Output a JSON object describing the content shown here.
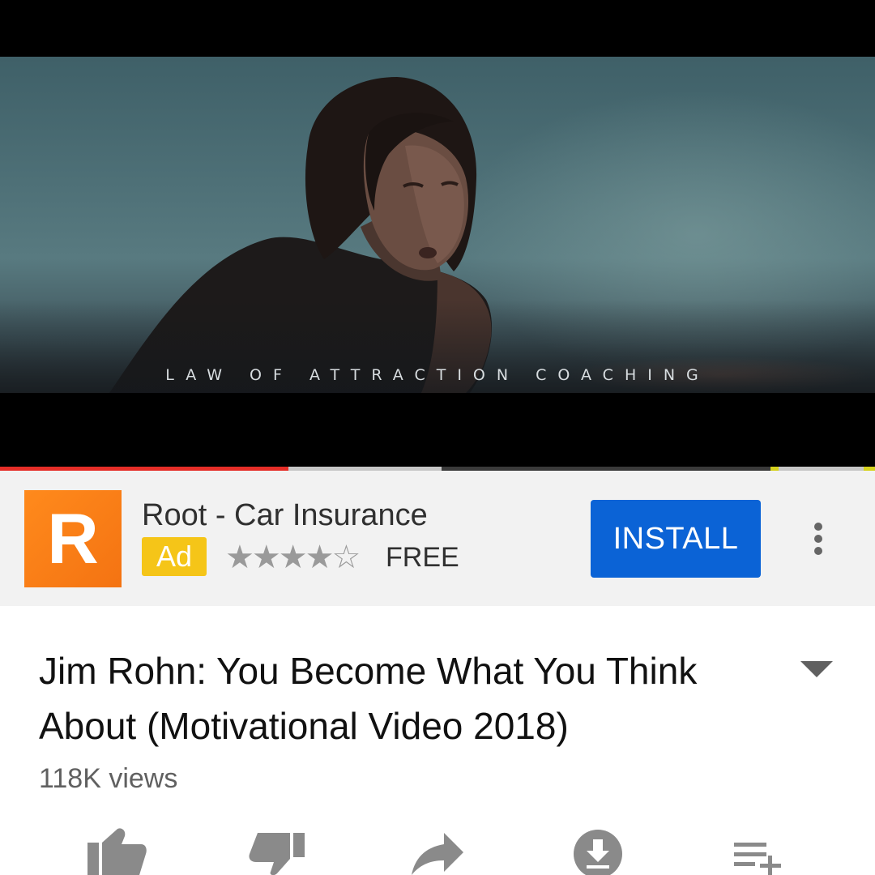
{
  "player": {
    "overlay_caption": "LAW OF ATTRACTION COACHING",
    "progress": {
      "played": 0.33,
      "buffered_to": 0.89,
      "accent": "#e52d27"
    }
  },
  "ad": {
    "logo_letter": "R",
    "title": "Root - Car Insurance",
    "badge": "Ad",
    "rating": 4.5,
    "rating_display": "★★★★☆",
    "price": "FREE",
    "install_label": "INSTALL",
    "button_color": "#0b63d6",
    "logo_color": "#f47312",
    "more_icon": "more-vertical-icon"
  },
  "video": {
    "title": "Jim Rohn: You Become What You Think About (Motivational Video 2018)",
    "views": "118K views",
    "expand_icon": "chevron-down-icon"
  },
  "actions": [
    {
      "name": "like",
      "icon": "thumbs-up-icon"
    },
    {
      "name": "dislike",
      "icon": "thumbs-down-icon"
    },
    {
      "name": "share",
      "icon": "share-icon"
    },
    {
      "name": "download",
      "icon": "download-icon"
    },
    {
      "name": "save",
      "icon": "add-to-playlist-icon"
    }
  ]
}
